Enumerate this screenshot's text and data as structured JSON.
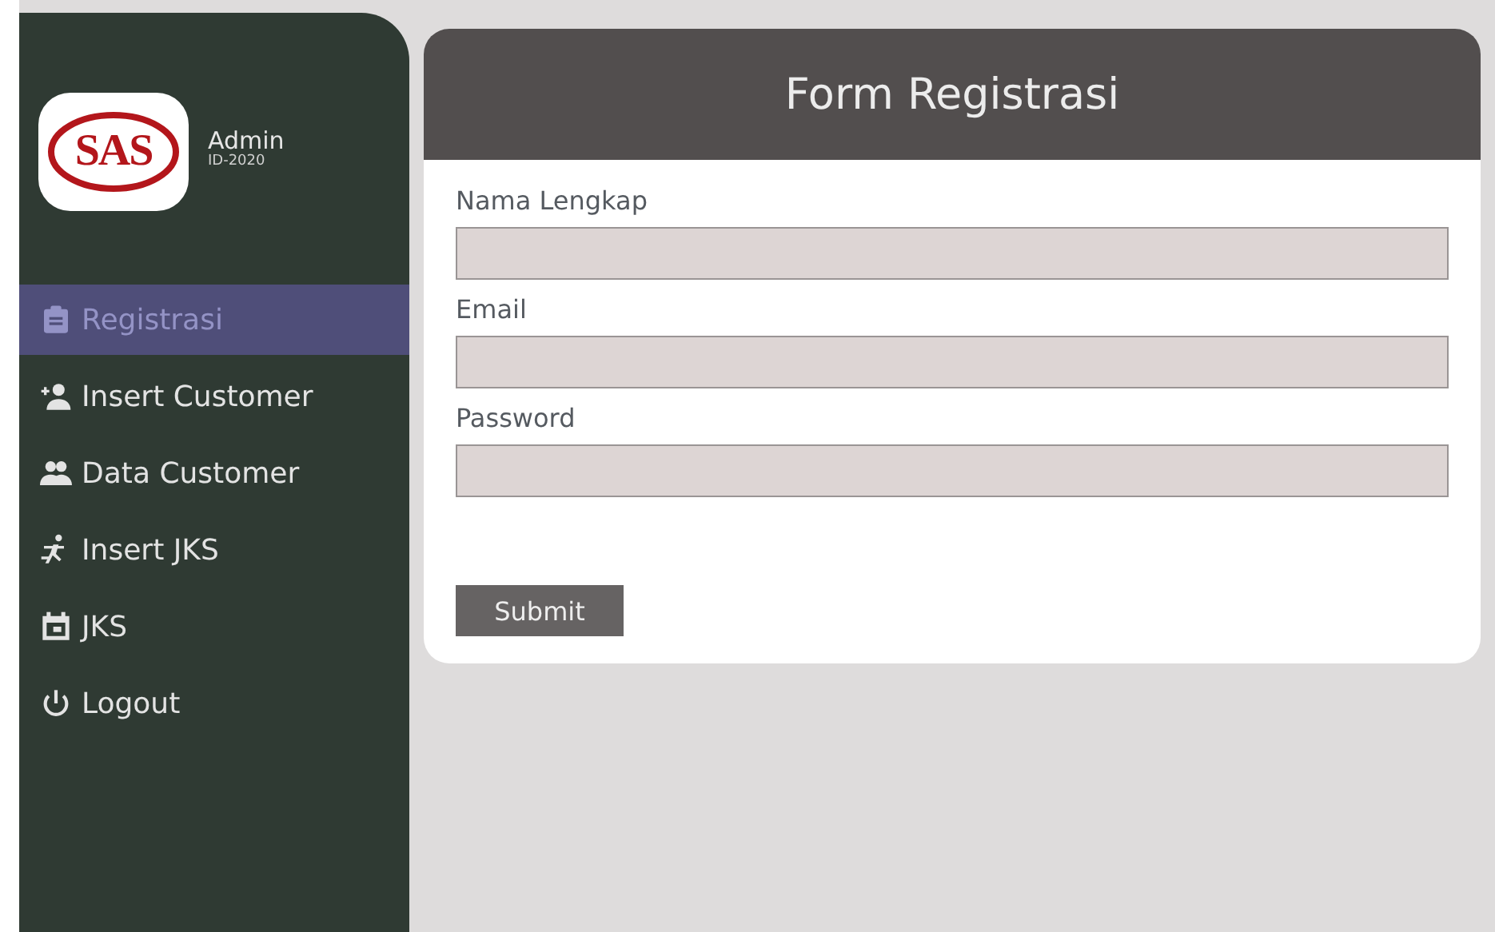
{
  "sidebar": {
    "logo": {
      "text": "SAS"
    },
    "user": {
      "name": "Admin",
      "id": "ID-2020"
    },
    "items": [
      {
        "label": "Registrasi",
        "selected": true
      },
      {
        "label": "Insert Customer",
        "selected": false
      },
      {
        "label": "Data Customer",
        "selected": false
      },
      {
        "label": "Insert JKS",
        "selected": false
      },
      {
        "label": "JKS",
        "selected": false
      },
      {
        "label": "Logout",
        "selected": false
      }
    ]
  },
  "form": {
    "title": "Form Registrasi",
    "fields": [
      {
        "label": "Nama Lengkap"
      },
      {
        "label": "Email"
      },
      {
        "label": "Password"
      }
    ],
    "submit": "Submit"
  }
}
